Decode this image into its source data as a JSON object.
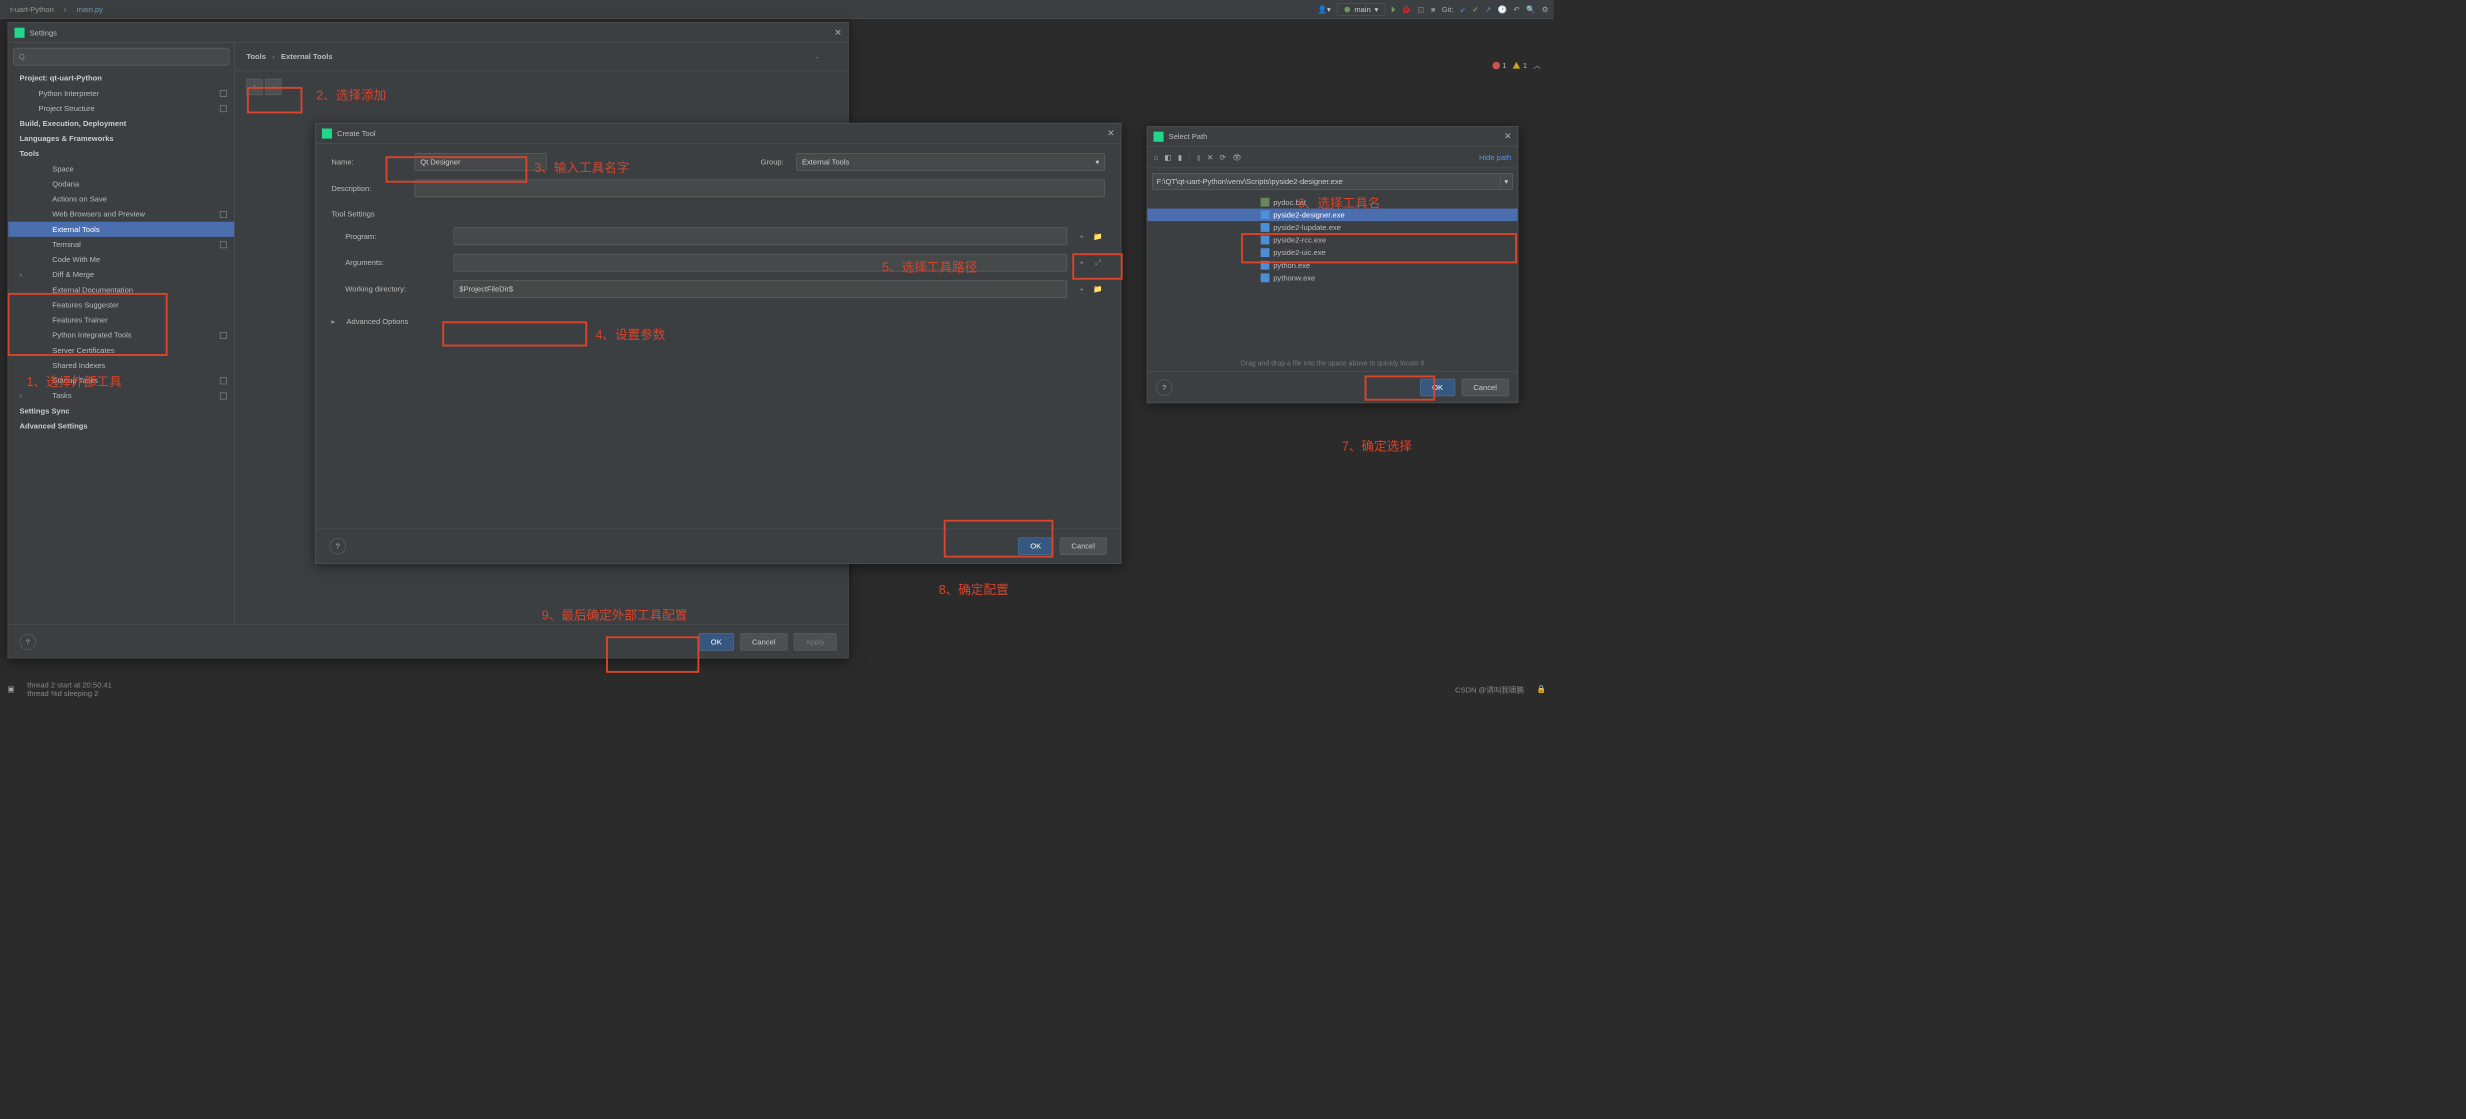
{
  "toolbar": {
    "project_path": "t-uart-Python",
    "file_tab": "main.py",
    "run_config": "main",
    "git_label": "Git:"
  },
  "settings": {
    "title": "Settings",
    "search_placeholder": "Q",
    "breadcrumb_tools": "Tools",
    "breadcrumb_sep": "›",
    "breadcrumb_ext": "External Tools",
    "tree": {
      "project": "Project: qt-uart-Python",
      "interpreter": "Python Interpreter",
      "structure": "Project Structure",
      "build": "Build, Execution, Deployment",
      "lang": "Languages & Frameworks",
      "tools": "Tools",
      "space": "Space",
      "qodana": "Qodana",
      "actions": "Actions on Save",
      "web": "Web Browsers and Preview",
      "external": "External Tools",
      "terminal": "Terminal",
      "codewithme": "Code With Me",
      "diffmerge": "Diff & Merge",
      "extdoc": "External Documentation",
      "featsugg": "Features Suggester",
      "feattrain": "Features Trainer",
      "pyint": "Python Integrated Tools",
      "servercert": "Server Certificates",
      "sharedidx": "Shared Indexes",
      "startup": "Startup Tasks",
      "tasks": "Tasks",
      "sync": "Settings Sync",
      "adv": "Advanced Settings"
    },
    "ok": "OK",
    "cancel": "Cancel",
    "apply": "Apply"
  },
  "create_tool": {
    "title": "Create Tool",
    "name_lbl": "Name:",
    "name_val": "Qt Designer",
    "group_lbl": "Group:",
    "group_val": "External Tools",
    "desc_lbl": "Description:",
    "tool_settings": "Tool Settings",
    "program_lbl": "Program:",
    "args_lbl": "Arguments:",
    "wd_lbl": "Working directory:",
    "wd_val": "$ProjectFileDir$",
    "adv": "Advanced Options",
    "ok": "OK",
    "cancel": "Cancel"
  },
  "select_path": {
    "title": "Select Path",
    "hide": "Hide path",
    "path": "F:\\QT\\qt-uart-Python\\venv\\Scripts\\pyside2-designer.exe",
    "items": [
      {
        "name": "pydoc.bat",
        "sel": false,
        "exe": false
      },
      {
        "name": "pyside2-designer.exe",
        "sel": true,
        "exe": true
      },
      {
        "name": "pyside2-lupdate.exe",
        "sel": false,
        "exe": true
      },
      {
        "name": "pyside2-rcc.exe",
        "sel": false,
        "exe": true
      },
      {
        "name": "pyside2-uic.exe",
        "sel": false,
        "exe": true
      },
      {
        "name": "python.exe",
        "sel": false,
        "exe": true
      },
      {
        "name": "pythonw.exe",
        "sel": false,
        "exe": true
      }
    ],
    "hint": "Drag and drop a file into the space above to quickly locate it",
    "ok": "OK",
    "cancel": "Cancel"
  },
  "status": {
    "line1": "thread 2    start at 20:50:41",
    "line2": "thread %d   sleeping 2",
    "watermark": "CSDN @请叫我啸鹏"
  },
  "errors": {
    "err": "1",
    "warn": "1"
  },
  "annotations": {
    "a1": "1、选择外部工具",
    "a2": "2、选择添加",
    "a3": "3、输入工具名字",
    "a4": "4、设置参数",
    "a5": "5、选择工具路径",
    "a6": "6、选择工具名",
    "a7": "7、确定选择",
    "a8": "8、确定配置",
    "a9": "9、最后确定外部工具配置"
  }
}
